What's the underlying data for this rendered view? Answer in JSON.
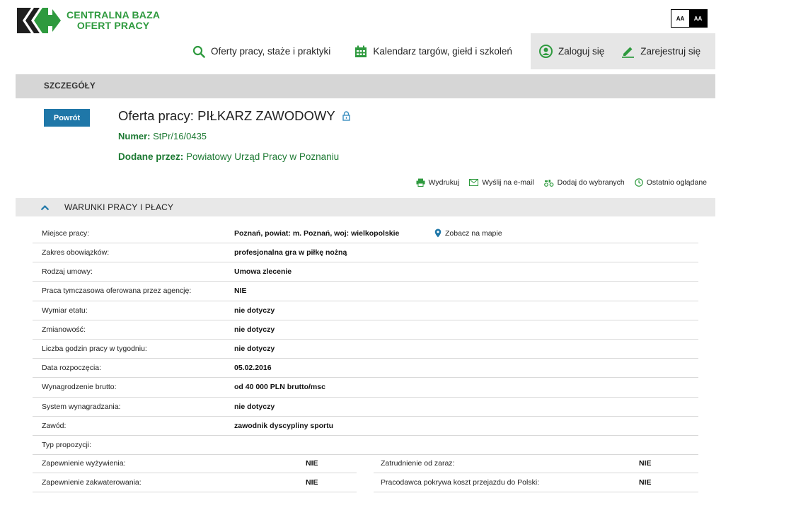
{
  "header": {
    "logo_line1": "CENTRALNA BAZA",
    "logo_line2": "OFERT PRACY",
    "font_small": "AA",
    "font_large": "AA",
    "brand_color": "#2e9a3e"
  },
  "nav": {
    "offers": "Oferty pracy, staże i praktyki",
    "calendar": "Kalendarz targów, giełd i szkoleń",
    "login": "Zaloguj się",
    "register": "Zarejestruj się"
  },
  "bar_title": "SZCZEGÓŁY",
  "back_button": "Powrót",
  "offer": {
    "title": "Oferta pracy: PIŁKARZ ZAWODOWY",
    "number_label": "Numer:",
    "number": "StPr/16/0435",
    "added_by_label": "Dodane przez:",
    "added_by": "Powiatowy Urząd Pracy w Poznaniu"
  },
  "actions": {
    "print": "Wydrukuj",
    "email": "Wyślij na e-mail",
    "favorite": "Dodaj do wybranych",
    "recent": "Ostatnio oglądane"
  },
  "section_title": "WARUNKI PRACY I PŁACY",
  "map_link": "Zobacz na mapie",
  "rows": [
    {
      "label": "Miejsce pracy:",
      "value": "Poznań, powiat: m. Poznań, woj: wielkopolskie"
    },
    {
      "label": "Zakres obowiązków:",
      "value": "profesjonalna gra w piłkę nożną"
    },
    {
      "label": "Rodzaj umowy:",
      "value": "Umowa zlecenie"
    },
    {
      "label": "Praca tymczasowa oferowana przez agencję:",
      "value": "NIE"
    },
    {
      "label": "Wymiar etatu:",
      "value": "nie dotyczy"
    },
    {
      "label": "Zmianowość:",
      "value": "nie dotyczy"
    },
    {
      "label": "Liczba godzin pracy w tygodniu:",
      "value": "nie dotyczy"
    },
    {
      "label": "Data rozpoczęcia:",
      "value": "05.02.2016"
    },
    {
      "label": "Wynagrodzenie brutto:",
      "value": "od 40 000 PLN brutto/msc"
    },
    {
      "label": "System wynagradzania:",
      "value": "nie dotyczy"
    },
    {
      "label": "Zawód:",
      "value": "zawodnik dyscypliny sportu"
    },
    {
      "label": "Typ propozycji:",
      "value": ""
    }
  ],
  "half_rows": [
    {
      "left_label": "Zapewnienie wyżywienia:",
      "left_value": "NIE",
      "right_label": "Zatrudnienie od zaraz:",
      "right_value": "NIE"
    },
    {
      "left_label": "Zapewnienie zakwaterowania:",
      "left_value": "NIE",
      "right_label": "Pracodawca pokrywa koszt przejazdu do Polski:",
      "right_value": "NIE"
    }
  ]
}
